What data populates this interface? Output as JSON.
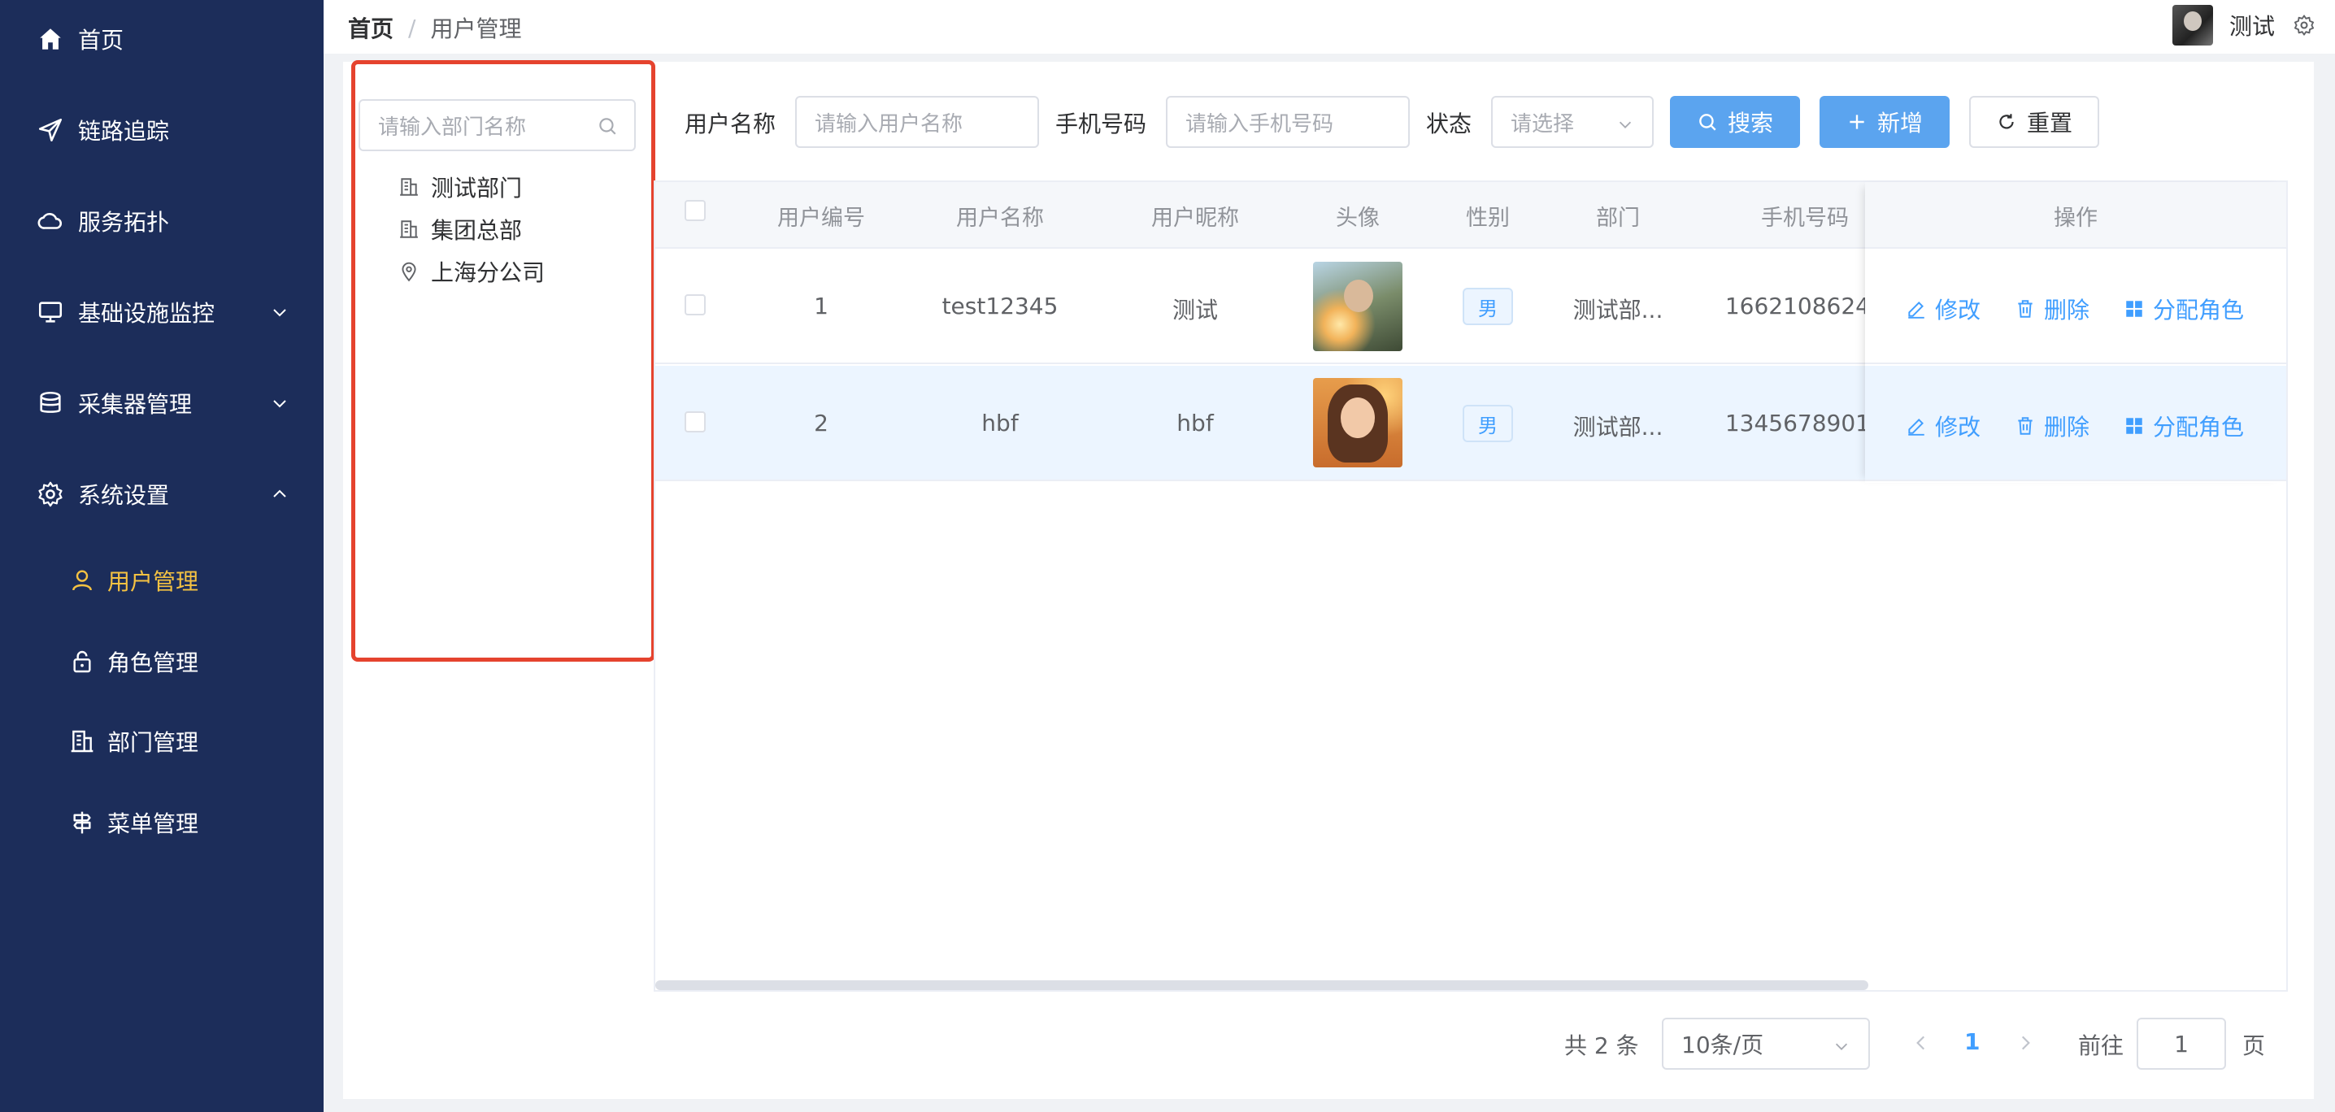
{
  "sidebar": {
    "items": [
      {
        "label": "首页",
        "icon": "home-icon"
      },
      {
        "label": "链路追踪",
        "icon": "send-icon"
      },
      {
        "label": "服务拓扑",
        "icon": "cloud-icon"
      },
      {
        "label": "基础设施监控",
        "icon": "monitor-icon"
      },
      {
        "label": "采集器管理",
        "icon": "database-icon"
      },
      {
        "label": "系统设置",
        "icon": "gear-icon"
      }
    ],
    "submenu": [
      {
        "label": "用户管理",
        "icon": "user-icon",
        "active": true
      },
      {
        "label": "角色管理",
        "icon": "lock-icon"
      },
      {
        "label": "部门管理",
        "icon": "building-icon"
      },
      {
        "label": "菜单管理",
        "icon": "signpost-icon"
      }
    ]
  },
  "header": {
    "breadcrumb": [
      "首页",
      "用户管理"
    ],
    "user_name": "测试"
  },
  "tree": {
    "search_placeholder": "请输入部门名称",
    "nodes": [
      {
        "label": "测试部门",
        "icon": "building-icon"
      },
      {
        "label": "集团总部",
        "icon": "building-icon"
      },
      {
        "label": "上海分公司",
        "icon": "location-icon"
      }
    ]
  },
  "filters": {
    "username_label": "用户名称",
    "username_placeholder": "请输入用户名称",
    "phone_label": "手机号码",
    "phone_placeholder": "请输入手机号码",
    "status_label": "状态",
    "status_placeholder": "请选择",
    "search_button": "搜索",
    "add_button": "新增",
    "reset_button": "重置"
  },
  "table": {
    "columns": [
      "用户编号",
      "用户名称",
      "用户昵称",
      "头像",
      "性别",
      "部门",
      "手机号码",
      "操作"
    ],
    "rows": [
      {
        "id": "1",
        "username": "test12345",
        "nickname": "测试",
        "gender": "男",
        "dept": "测试部...",
        "phone": "1662108624"
      },
      {
        "id": "2",
        "username": "hbf",
        "nickname": "hbf",
        "gender": "男",
        "dept": "测试部...",
        "phone": "1345678901"
      }
    ],
    "actions": {
      "edit": "修改",
      "delete": "删除",
      "assign": "分配角色"
    }
  },
  "pagination": {
    "total": "共 2 条",
    "page_size": "10条/页",
    "current_page": "1",
    "goto_label": "前往",
    "goto_value": "1",
    "page_suffix": "页"
  },
  "colors": {
    "sidebar_bg": "#1c2d5a",
    "active_menu": "#f5c242",
    "primary": "#5ba4ef",
    "link": "#409eff",
    "highlight_border": "#e5432e"
  }
}
